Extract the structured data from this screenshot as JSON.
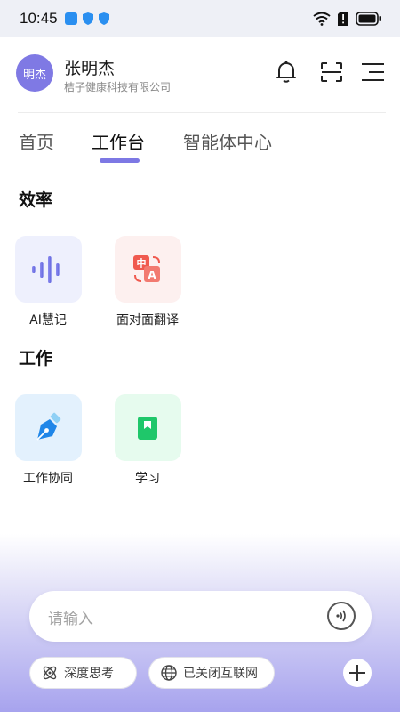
{
  "status_bar": {
    "time": "10:45"
  },
  "user": {
    "avatar_text": "明杰",
    "name": "张明杰",
    "company": "桔子健康科技有限公司"
  },
  "tabs": [
    {
      "label": "首页",
      "active": false
    },
    {
      "label": "工作台",
      "active": true
    },
    {
      "label": "智能体中心",
      "active": false
    }
  ],
  "sections": {
    "efficiency": {
      "title": "效率",
      "items": [
        {
          "label": "AI慧记",
          "icon": "voice-wave-icon",
          "bg": "#eef0fd"
        },
        {
          "label": "面对面翻译",
          "icon": "translate-icon",
          "bg": "#fdf0ef"
        }
      ]
    },
    "work": {
      "title": "工作",
      "items": [
        {
          "label": "工作协同",
          "icon": "pen-nib-icon",
          "bg": "#e3f1fd"
        },
        {
          "label": "学习",
          "icon": "book-icon",
          "bg": "#e6fbee"
        }
      ]
    }
  },
  "chat": {
    "placeholder": "请输入",
    "deep_think_label": "深度思考",
    "internet_label": "已关闭互联网"
  },
  "colors": {
    "accent": "#7d78e4",
    "avatar_bg": "#7f79e4"
  }
}
